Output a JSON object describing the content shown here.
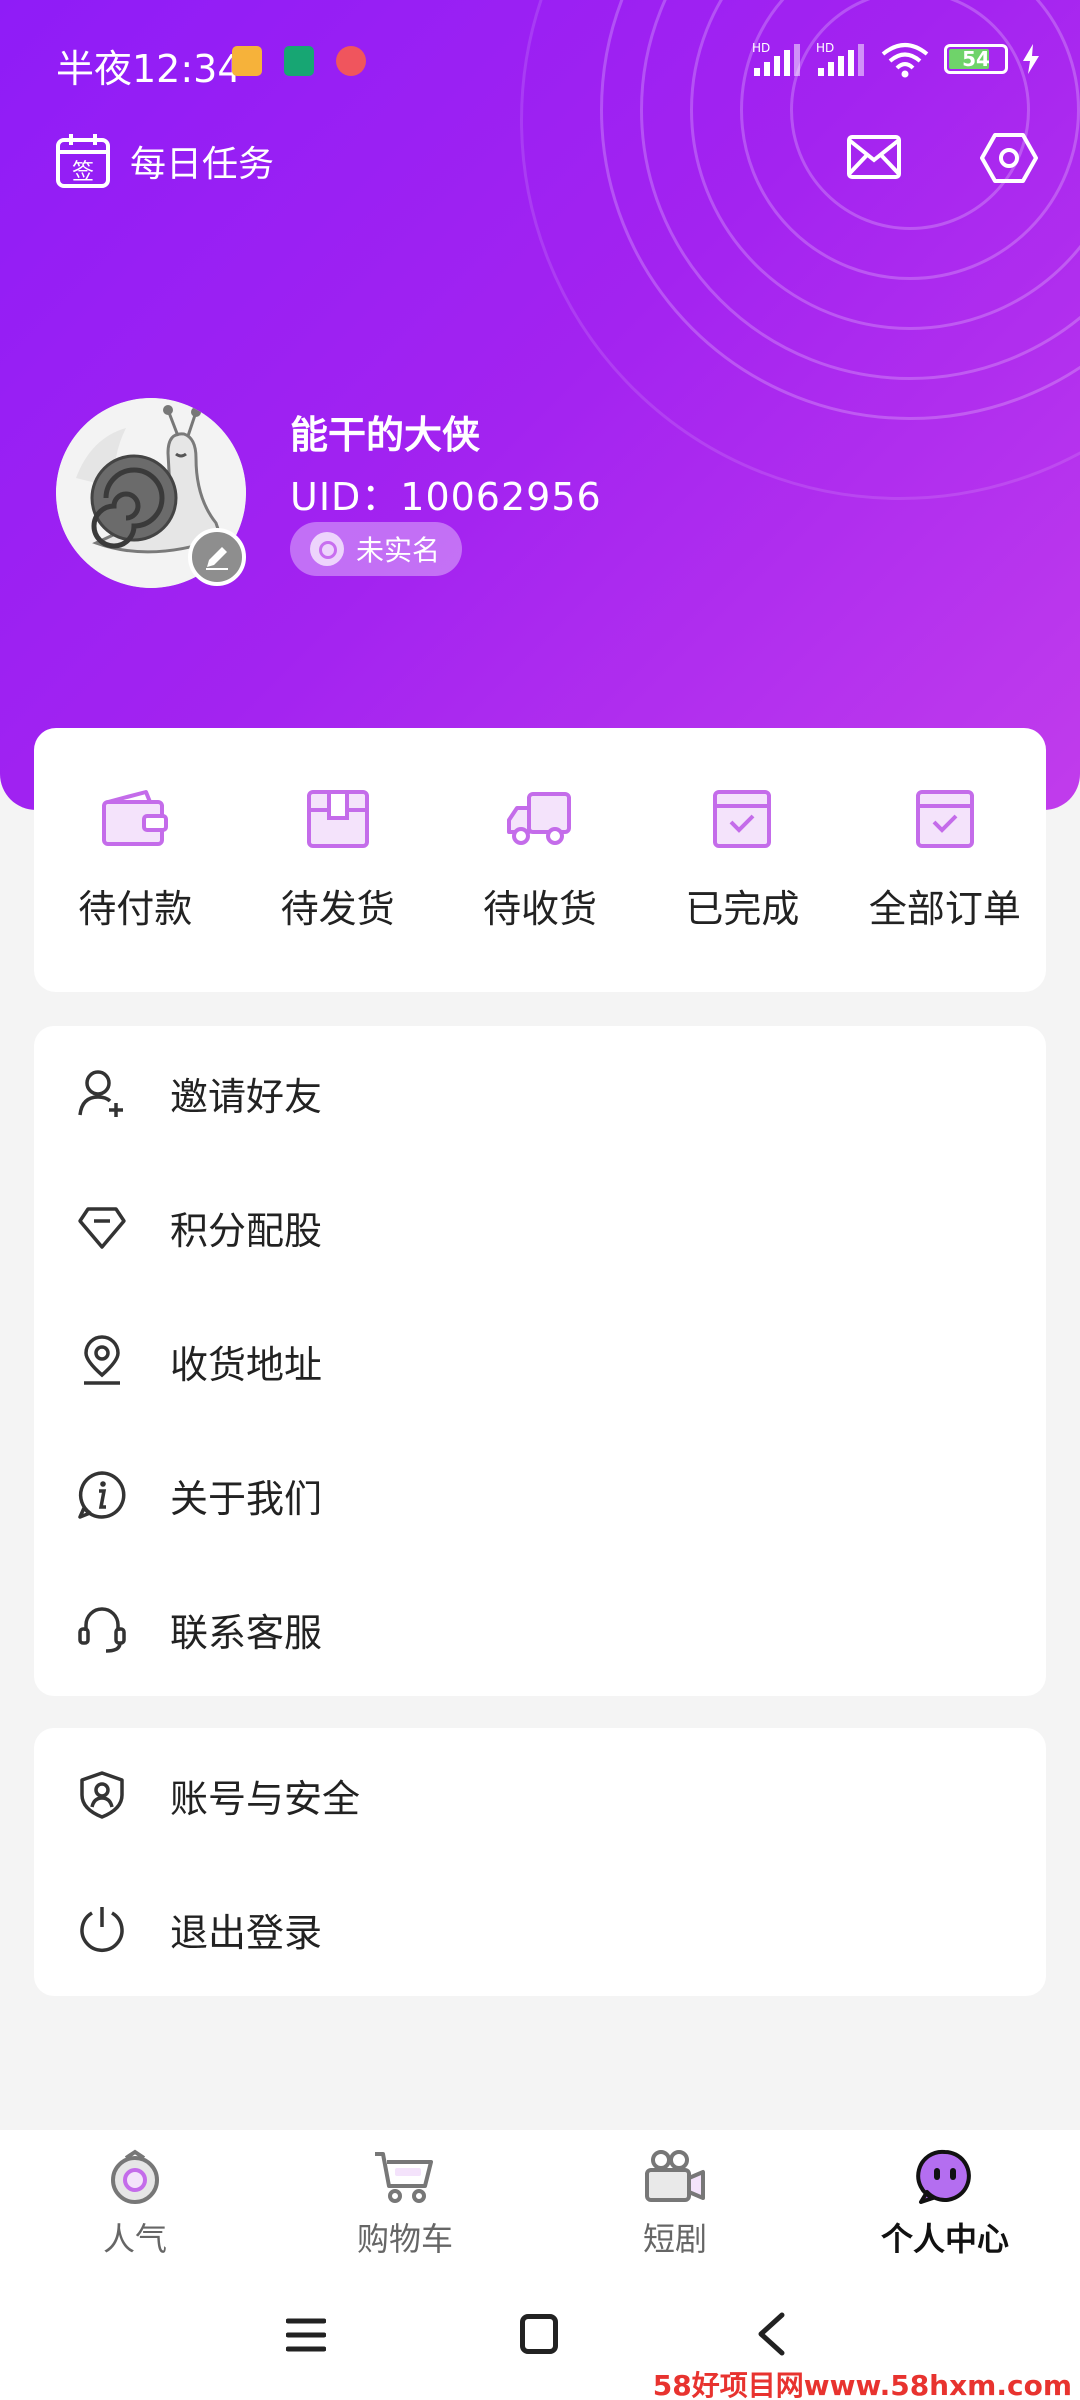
{
  "status_bar": {
    "time": "半夜12:34",
    "battery": "54",
    "signal1_label": "HD",
    "signal2_label": "HD"
  },
  "header": {
    "daily_tasks_icon_char": "签",
    "daily_tasks_label": "每日任务"
  },
  "profile": {
    "nickname": "能干的大侠",
    "uid": "UID：10062956",
    "verify_status": "未实名"
  },
  "orders": [
    {
      "label": "待付款",
      "icon": "wallet-icon"
    },
    {
      "label": "待发货",
      "icon": "package-icon"
    },
    {
      "label": "待收货",
      "icon": "truck-icon"
    },
    {
      "label": "已完成",
      "icon": "box-check-icon"
    },
    {
      "label": "全部订单",
      "icon": "box-check-icon"
    }
  ],
  "menu": [
    {
      "label": "邀请好友",
      "icon": "user-add-icon"
    },
    {
      "label": "积分配股",
      "icon": "diamond-icon"
    },
    {
      "label": "收货地址",
      "icon": "location-pin-icon"
    },
    {
      "label": "关于我们",
      "icon": "info-icon"
    },
    {
      "label": "联系客服",
      "icon": "headset-icon"
    }
  ],
  "menu2": [
    {
      "label": "账号与安全",
      "icon": "shield-user-icon"
    },
    {
      "label": "退出登录",
      "icon": "power-icon"
    }
  ],
  "bottom_nav": [
    {
      "label": "人气",
      "icon": "popularity-icon"
    },
    {
      "label": "购物车",
      "icon": "cart-icon"
    },
    {
      "label": "短剧",
      "icon": "video-camera-icon"
    },
    {
      "label": "个人中心",
      "icon": "profile-face-icon",
      "active": true
    }
  ],
  "watermark": "58好项目网www.58hxm.com",
  "colors": {
    "brand_purple": "#9b22f2",
    "icon_purple": "#c46cea",
    "background": "#f4f4f4"
  }
}
